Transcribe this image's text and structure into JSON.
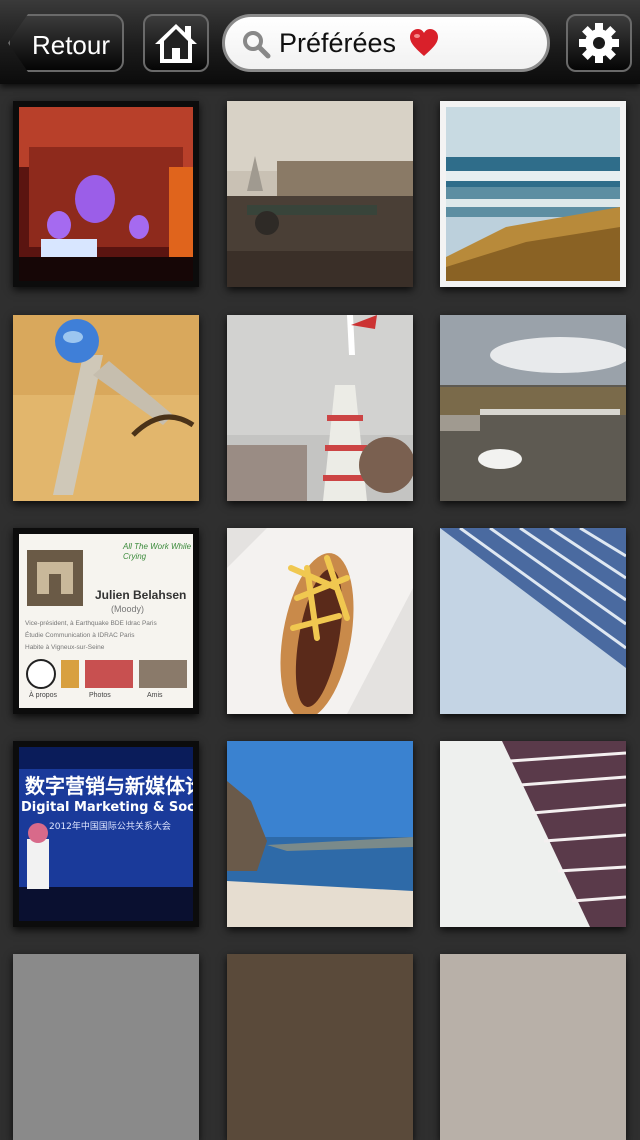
{
  "nav": {
    "back_label": "Retour",
    "home_icon": "home-icon",
    "settings_icon": "gear-icon"
  },
  "search": {
    "label": "Préférées",
    "heart": "heart-icon"
  },
  "colors": {
    "bar_dark": "#0b0b0b",
    "background": "#2f2f2f",
    "heart_red": "#d9202a"
  },
  "profile_card": {
    "note": "All The Work While Crying",
    "name": "Julien Belahsen",
    "nickname": "(Moody)",
    "lines": [
      "Vice-président, à Earthquake BDE Idrac Paris",
      "Étudie Communication à IDRAC Paris",
      "Habite à Vigneux-sur-Seine"
    ],
    "tabs": [
      "À propos",
      "Photos",
      "Amis"
    ]
  },
  "conference_banner": {
    "line1": "数字营销与新媒体论坛",
    "line2": "Digital Marketing & Social Media",
    "line3": "2012年中国国际公共关系大会"
  }
}
